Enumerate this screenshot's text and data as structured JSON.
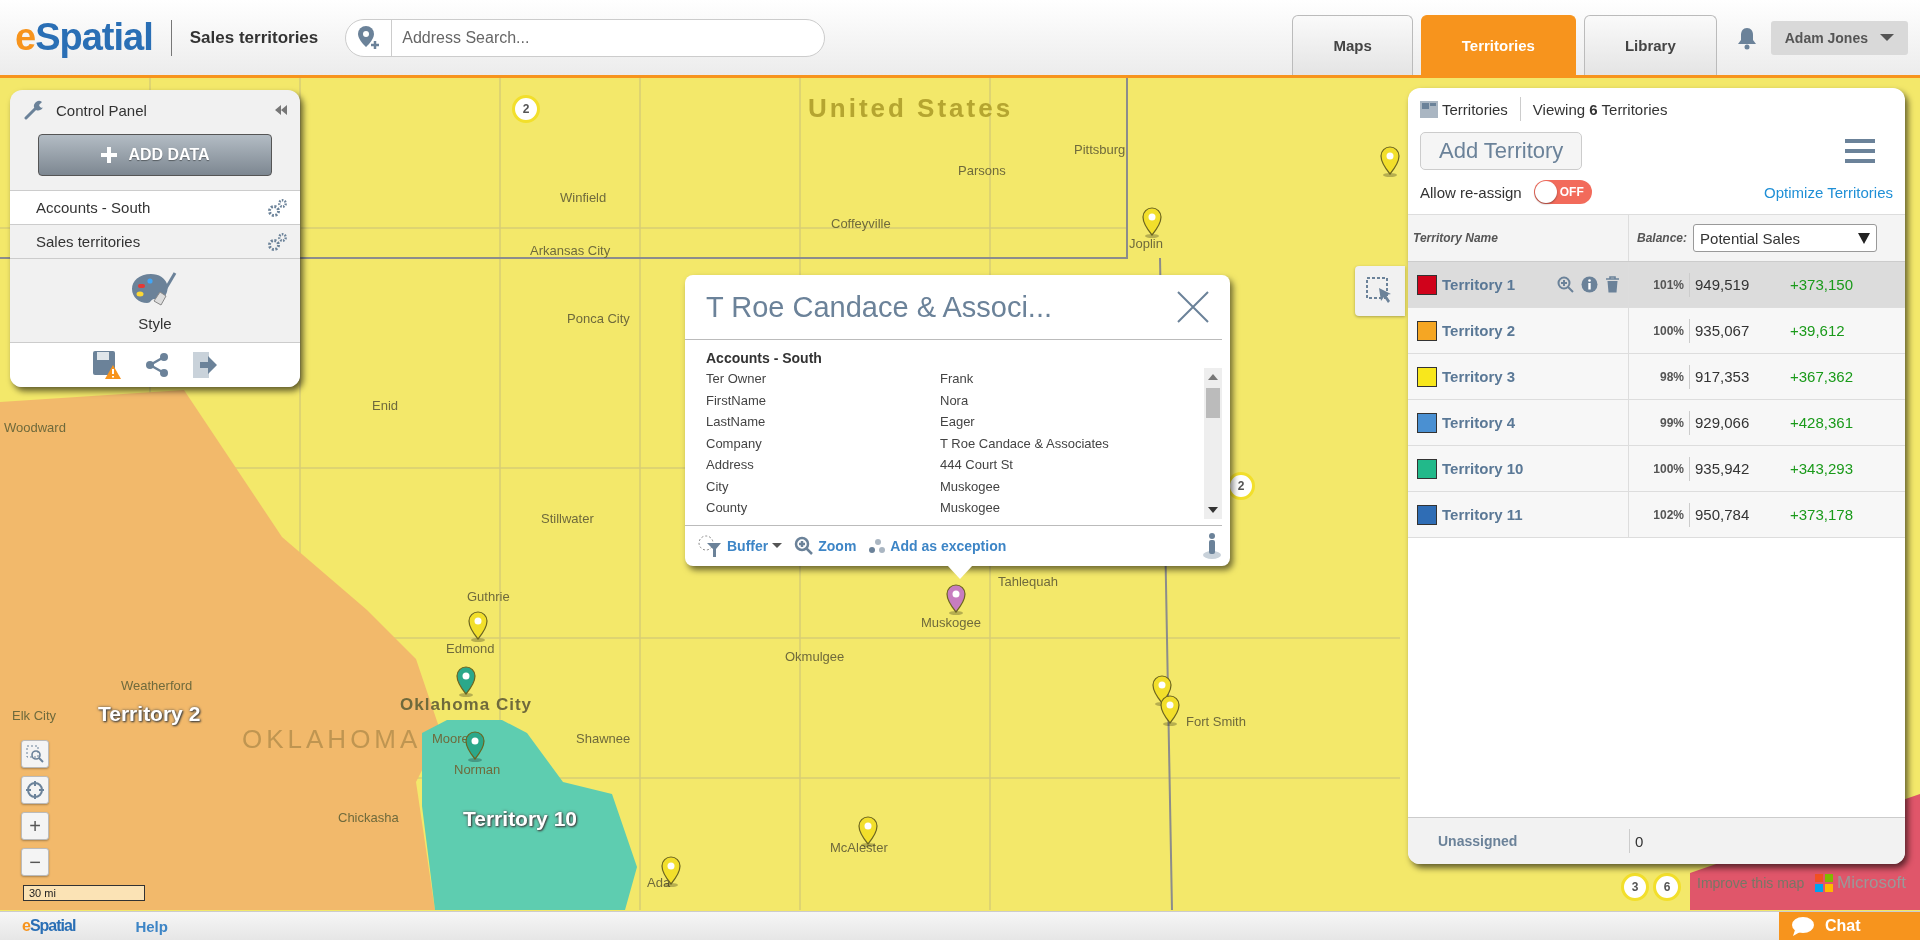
{
  "header": {
    "logo": {
      "accent": "e",
      "text": "Spatial"
    },
    "title": "Sales territories",
    "search": {
      "placeholder": "Address Search..."
    },
    "tabs": [
      {
        "label": "Maps",
        "selected": false
      },
      {
        "label": "Territories",
        "selected": true
      },
      {
        "label": "Library",
        "selected": false
      }
    ],
    "user": "Adam Jones"
  },
  "control_panel": {
    "title": "Control Panel",
    "add_button": "ADD DATA",
    "layers": [
      "Accounts - South",
      "Sales territories"
    ],
    "style_label": "Style"
  },
  "map": {
    "labels": [
      {
        "kind": "country",
        "text": "United States"
      },
      {
        "kind": "city",
        "text": "Pittsburg"
      },
      {
        "kind": "city",
        "text": "Parsons"
      },
      {
        "kind": "city",
        "text": "Winfield"
      },
      {
        "kind": "city",
        "text": "Arkansas City"
      },
      {
        "kind": "city",
        "text": "Coffeyville"
      },
      {
        "kind": "city",
        "text": "Joplin"
      },
      {
        "kind": "city",
        "text": "Ponca City"
      },
      {
        "kind": "city",
        "text": "Enid"
      },
      {
        "kind": "city",
        "text": "Woodward"
      },
      {
        "kind": "city",
        "text": "Stillwater"
      },
      {
        "kind": "city",
        "text": "Guthrie"
      },
      {
        "kind": "city",
        "text": "Edmond"
      },
      {
        "kind": "city",
        "text": "Tahlequah"
      },
      {
        "kind": "city",
        "text": "Muskogee"
      },
      {
        "kind": "city",
        "text": "Okmulgee"
      },
      {
        "kind": "city",
        "text": "Weatherford"
      },
      {
        "kind": "city",
        "text": "Elk City"
      },
      {
        "kind": "major",
        "text": "Oklahoma City"
      },
      {
        "kind": "city",
        "text": "Moore"
      },
      {
        "kind": "city",
        "text": "Shawnee"
      },
      {
        "kind": "city",
        "text": "Norman"
      },
      {
        "kind": "city",
        "text": "Fort Smith"
      },
      {
        "kind": "city",
        "text": "Chickasha"
      },
      {
        "kind": "city",
        "text": "McAlester"
      },
      {
        "kind": "city",
        "text": "Ada"
      },
      {
        "kind": "territory",
        "text": "Territory 2"
      },
      {
        "kind": "state",
        "text": "OKLAHOMA"
      },
      {
        "kind": "territory",
        "text": "Territory 10"
      }
    ],
    "badges": [
      "2",
      "2",
      "3",
      "6"
    ],
    "pins": [
      {
        "color": "#f2df2b"
      },
      {
        "color": "#f2df2b"
      },
      {
        "color": "#f2df2b"
      },
      {
        "color": "#c77dc0"
      },
      {
        "color": "#2ba88a"
      },
      {
        "color": "#2ba88a"
      },
      {
        "color": "#f2df2b"
      },
      {
        "color": "#f2df2b"
      },
      {
        "color": "#f2df2b"
      },
      {
        "color": "#f2df2b"
      }
    ],
    "zoom_in": "+",
    "zoom_out": "−",
    "scale": "30 mi",
    "attribution": "Improve this map",
    "provider": "Microsoft"
  },
  "popup": {
    "title": "T Roe Candace & Associ...",
    "section": "Accounts - South",
    "fields": [
      {
        "label": "Ter Owner",
        "value": "Frank"
      },
      {
        "label": "FirstName",
        "value": "Nora"
      },
      {
        "label": "LastName",
        "value": "Eager"
      },
      {
        "label": "Company",
        "value": "T Roe Candace & Associates"
      },
      {
        "label": "Address",
        "value": "444 Court St"
      },
      {
        "label": "City",
        "value": "Muskogee"
      },
      {
        "label": "County",
        "value": "Muskogee"
      }
    ],
    "actions": [
      "Buffer",
      "Zoom",
      "Add as exception"
    ]
  },
  "territory_panel": {
    "title": "Territories",
    "viewing": "Viewing **6** Territories",
    "add_button": "Add Territory",
    "allow_reassign": {
      "label": "Allow re-assign",
      "on": false,
      "state_label": "OFF"
    },
    "optimize": "Optimize Territories",
    "columns": {
      "name": "Territory Name",
      "balance": "Balance:",
      "metric": "Potential Sales"
    },
    "rows": [
      {
        "name": "Territory 1",
        "color": "#d0021b",
        "selected": true,
        "percent": "101%",
        "value": "949,519",
        "difference": "+373,150"
      },
      {
        "name": "Territory 2",
        "color": "#f5a623",
        "selected": false,
        "percent": "100%",
        "value": "935,067",
        "difference": "+39,612"
      },
      {
        "name": "Territory 3",
        "color": "#f8e71c",
        "selected": false,
        "percent": "98%",
        "value": "917,353",
        "difference": "+367,362"
      },
      {
        "name": "Territory 4",
        "color": "#4a90d2",
        "selected": false,
        "percent": "99%",
        "value": "929,066",
        "difference": "+428,361"
      },
      {
        "name": "Territory 10",
        "color": "#22b98a",
        "selected": false,
        "percent": "100%",
        "value": "935,942",
        "difference": "+343,293"
      },
      {
        "name": "Territory 11",
        "color": "#2f6db5",
        "selected": false,
        "percent": "102%",
        "value": "950,784",
        "difference": "+373,178"
      }
    ],
    "unassigned": {
      "name": "Unassigned",
      "value": "0"
    }
  },
  "footer": {
    "logo": {
      "accent": "e",
      "text": "Spatial"
    },
    "help": "Help",
    "chat": "Chat"
  }
}
